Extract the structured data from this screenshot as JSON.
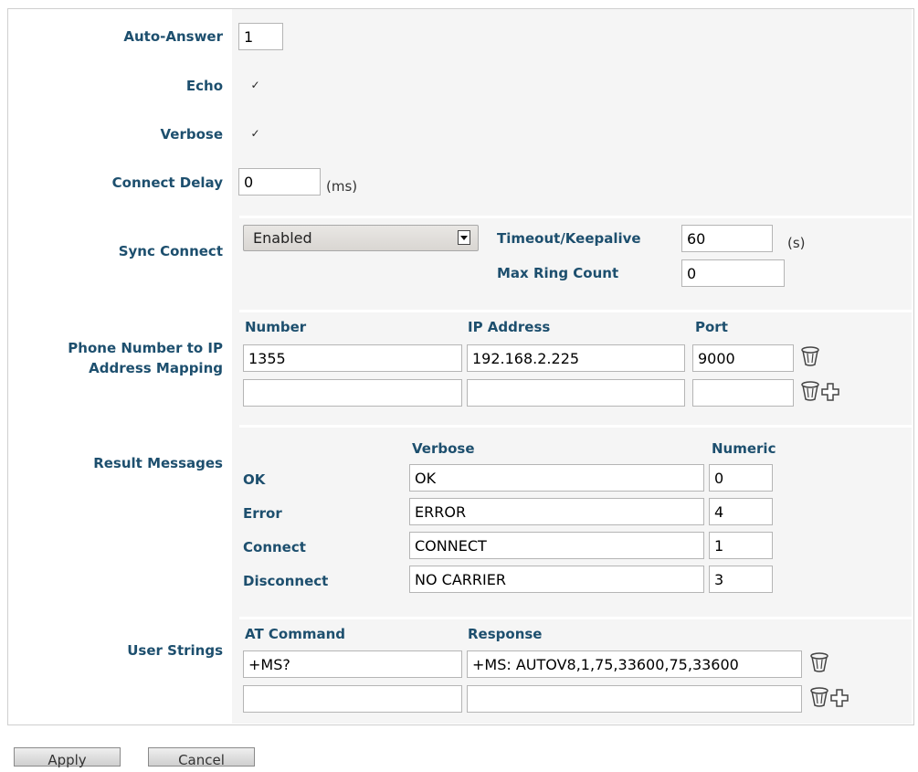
{
  "fields": {
    "auto_answer": {
      "label": "Auto-Answer",
      "value": "1"
    },
    "echo": {
      "label": "Echo",
      "checked": true
    },
    "verbose": {
      "label": "Verbose",
      "checked": true
    },
    "connect_delay": {
      "label": "Connect Delay",
      "value": "0",
      "unit": "(ms)"
    },
    "sync_connect": {
      "label": "Sync Connect",
      "selected": "Enabled",
      "timeout_label": "Timeout/Keepalive",
      "timeout_value": "60",
      "timeout_unit": "(s)",
      "ring_label": "Max Ring Count",
      "ring_value": "0"
    },
    "phone_mapping": {
      "label_line1": "Phone Number to IP",
      "label_line2": "Address Mapping",
      "headers": {
        "number": "Number",
        "ip": "IP Address",
        "port": "Port"
      },
      "rows": [
        {
          "number": "1355",
          "ip": "192.168.2.225",
          "port": "9000"
        },
        {
          "number": "",
          "ip": "",
          "port": ""
        }
      ]
    },
    "result_messages": {
      "label": "Result Messages",
      "headers": {
        "verbose": "Verbose",
        "numeric": "Numeric"
      },
      "rows": [
        {
          "name": "OK",
          "verbose": "OK",
          "numeric": "0"
        },
        {
          "name": "Error",
          "verbose": "ERROR",
          "numeric": "4"
        },
        {
          "name": "Connect",
          "verbose": "CONNECT",
          "numeric": "1"
        },
        {
          "name": "Disconnect",
          "verbose": "NO CARRIER",
          "numeric": "3"
        }
      ]
    },
    "user_strings": {
      "label": "User Strings",
      "headers": {
        "command": "AT Command",
        "response": "Response"
      },
      "rows": [
        {
          "command": "+MS?",
          "response": "+MS: AUTOV8,1,75,33600,75,33600"
        },
        {
          "command": "",
          "response": ""
        }
      ]
    }
  },
  "buttons": {
    "apply": "Apply",
    "cancel": "Cancel"
  },
  "icons": {
    "delete": "trash-icon",
    "add": "plus-icon"
  },
  "colors": {
    "label": "#1d4f6e",
    "panel_bg": "#f5f5f5",
    "border": "#cfcfcf"
  }
}
